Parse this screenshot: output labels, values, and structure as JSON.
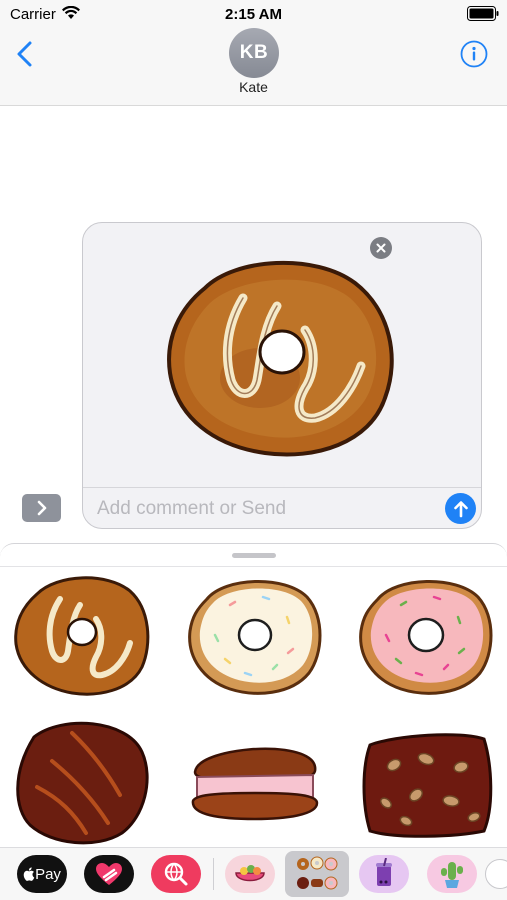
{
  "status_bar": {
    "carrier": "Carrier",
    "time": "2:15 AM"
  },
  "header": {
    "avatar_initials": "KB",
    "contact_name": "Kate"
  },
  "compose": {
    "placeholder": "Add comment or Send",
    "value": ""
  },
  "stickers": [
    {
      "name": "glazed-donut-sticker"
    },
    {
      "name": "white-sprinkle-donut-sticker"
    },
    {
      "name": "pink-sprinkle-donut-sticker"
    },
    {
      "name": "chocolate-candy-sticker"
    },
    {
      "name": "cream-sandwich-cookie-sticker"
    },
    {
      "name": "almond-chocolate-bar-sticker"
    }
  ],
  "app_strip": {
    "apple_pay_label": "Pay",
    "apps": [
      "apple-pay",
      "digital-touch",
      "image-search",
      "fruit-bowl-stickers",
      "donut-stickers",
      "bubble-tea-stickers",
      "cactus-stickers",
      "more-apps"
    ]
  },
  "colors": {
    "accent": "#1f82f6",
    "donut_glaze": "#b5651d",
    "icing": "#f5e9c8",
    "pink_frosting": "#f7b8bd",
    "chocolate": "#6b1e10"
  }
}
